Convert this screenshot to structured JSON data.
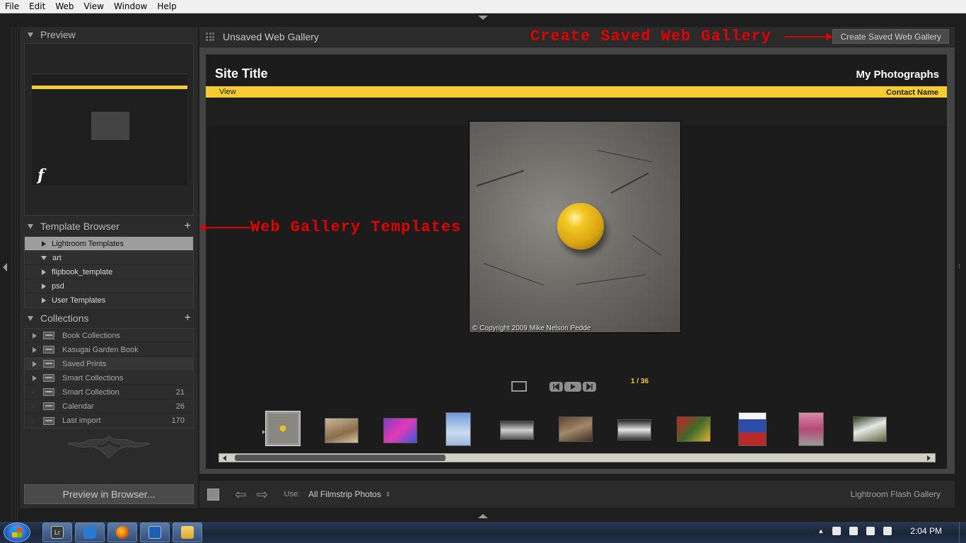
{
  "menu": [
    "File",
    "Edit",
    "Web",
    "View",
    "Window",
    "Help"
  ],
  "left_panel": {
    "preview": {
      "header": "Preview"
    },
    "template_browser": {
      "header": "Template Browser",
      "items": [
        {
          "label": "Lightroom Templates",
          "selected": true,
          "expanded": false
        },
        {
          "label": "art",
          "selected": false,
          "expanded": true
        },
        {
          "label": "flipbook_template",
          "selected": false,
          "expanded": false
        },
        {
          "label": "psd",
          "selected": false,
          "expanded": false
        },
        {
          "label": "User Templates",
          "selected": false,
          "expanded": false
        }
      ]
    },
    "collections": {
      "header": "Collections",
      "items": [
        {
          "label": "Book Collections",
          "count": ""
        },
        {
          "label": "Kasugai Garden Book",
          "count": ""
        },
        {
          "label": "Saved Prints",
          "count": ""
        },
        {
          "label": "Smart Collections",
          "count": ""
        },
        {
          "label": "Smart Collection",
          "count": "21"
        },
        {
          "label": "Calendar",
          "count": "26"
        },
        {
          "label": "Last import",
          "count": "170"
        }
      ]
    },
    "preview_button": "Preview in Browser..."
  },
  "toolbar": {
    "gallery_title": "Unsaved Web Gallery",
    "save_button": "Create Saved Web Gallery"
  },
  "gallery": {
    "site_title": "Site Title",
    "collection_title": "My Photographs",
    "view_label": "View",
    "contact_name": "Contact Name",
    "copyright": "© Copyright 2009 Mike Nelson Pedde",
    "page_indicator": "1 / 36",
    "thumbnail_count": 11
  },
  "bottom_bar": {
    "use_label": "Use:",
    "use_value": "All Filmstrip Photos",
    "engine": "Lightroom Flash Gallery"
  },
  "annotations": {
    "saved_gallery": "Create Saved Web Gallery",
    "templates": "Web Gallery Templates"
  },
  "taskbar": {
    "time": "2:04 PM"
  },
  "colors": {
    "accent_yellow": "#f5cc32",
    "annotation_red": "#e00000"
  }
}
